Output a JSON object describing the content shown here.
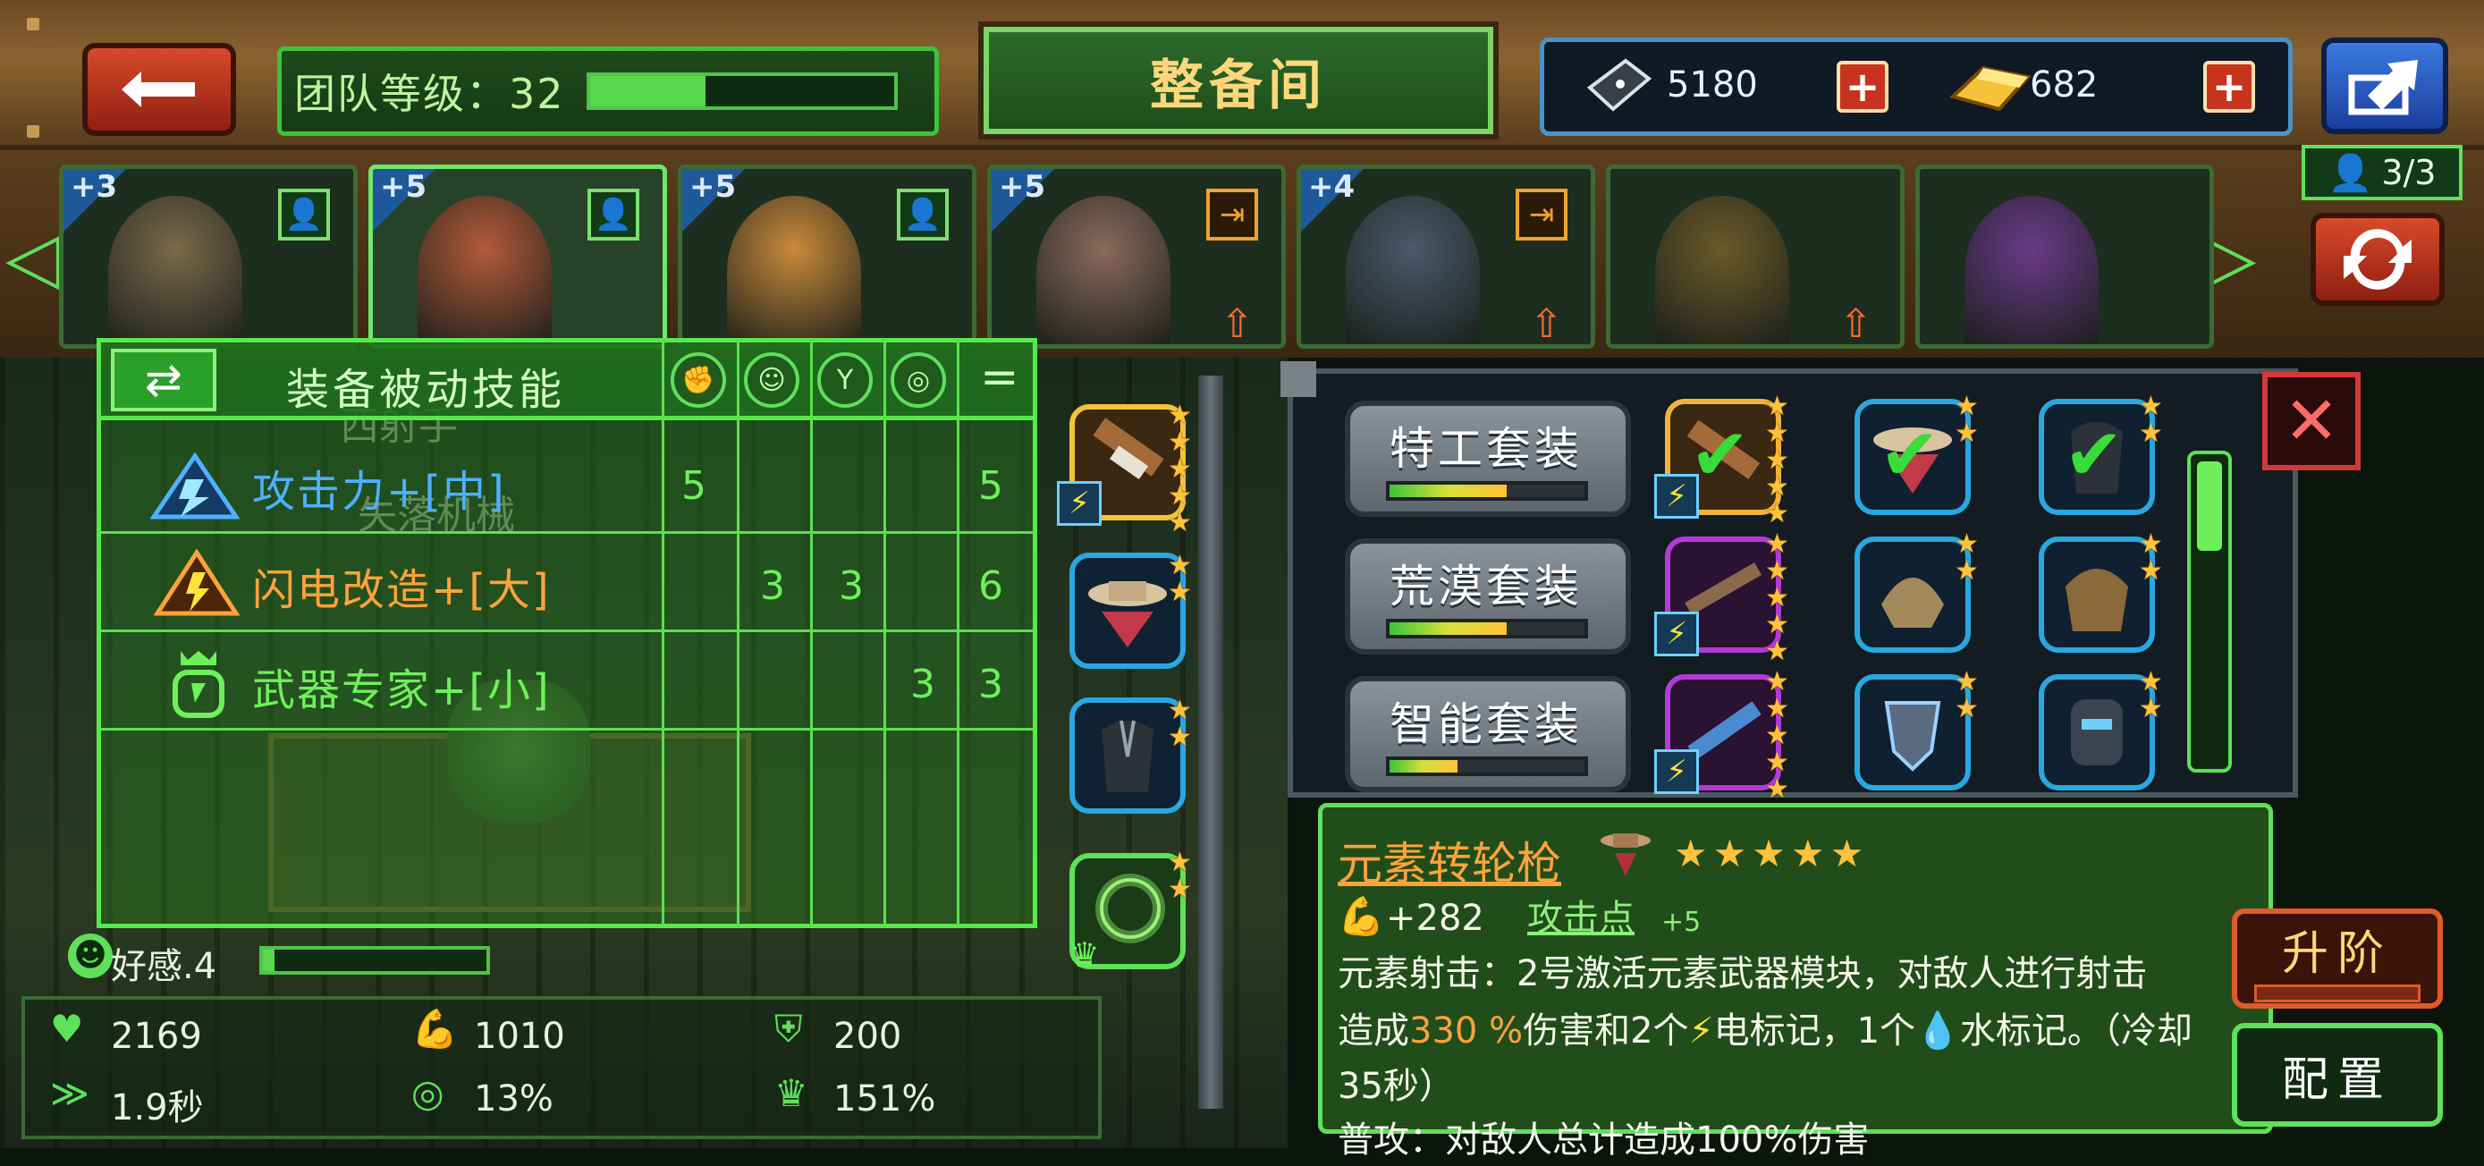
{
  "header": {
    "team_level_label": "团队等级：32",
    "team_level_progress": 0.38,
    "title": "整备间",
    "currency": [
      {
        "icon": "dark-gem-icon",
        "value": "5180"
      },
      {
        "icon": "gold-bar-icon",
        "value": "682"
      }
    ]
  },
  "roster": {
    "count": "3/3",
    "heroes": [
      {
        "stars": "+3",
        "badge": "person-icon",
        "selected": false
      },
      {
        "stars": "+5",
        "badge": "person-icon",
        "selected": true
      },
      {
        "stars": "+5",
        "badge": "person-icon",
        "selected": false
      },
      {
        "stars": "+5",
        "badge": "swap-badge-icon",
        "upgrade": true,
        "selected": false
      },
      {
        "stars": "+4",
        "badge": "swap-badge-icon",
        "upgrade": true,
        "selected": false
      },
      {
        "stars": "",
        "badge": "",
        "upgrade": true,
        "selected": false
      },
      {
        "stars": "",
        "badge": "",
        "selected": false
      }
    ]
  },
  "skills": {
    "title": "装备被动技能",
    "column_total_symbol": "=",
    "rows": [
      {
        "name": "攻击力+[中]",
        "color": "#4eb0ff",
        "values": [
          "5",
          "",
          "",
          "",
          "5"
        ]
      },
      {
        "name": "闪电改造+[大]",
        "color": "#ffa23a",
        "values": [
          "",
          "3",
          "3",
          "",
          "6"
        ]
      },
      {
        "name": "武器专家+[小]",
        "color": "#6ef05a",
        "values": [
          "",
          "",
          "",
          "3",
          "3"
        ]
      }
    ],
    "background_text": [
      "西射手",
      "失落机械"
    ]
  },
  "affinity": {
    "label": "好感.4",
    "progress": 0.05
  },
  "stats": [
    {
      "icon": "heart-icon",
      "value": "2169"
    },
    {
      "icon": "arm-strength-icon",
      "value": "1010"
    },
    {
      "icon": "armor-icon",
      "value": "200"
    },
    {
      "icon": "speed-wing-icon",
      "value": "1.9秒"
    },
    {
      "icon": "target-icon",
      "value": "13%"
    },
    {
      "icon": "crit-crown-icon",
      "value": "151%"
    }
  ],
  "inventory": {
    "sets": [
      {
        "name": "特工套装",
        "progress": 0.6
      },
      {
        "name": "荒漠套装",
        "progress": 0.6
      },
      {
        "name": "智能套装",
        "progress": 0.35
      }
    ]
  },
  "detail": {
    "item_name": "元素转轮枪",
    "stars": "★★★★★",
    "attack_bonus": "+282",
    "attack_point_label": "攻击点",
    "attack_point_value": "+5",
    "desc_line1": "元素射击：2号激活元素武器模块，对敌人进行射击",
    "desc_line2_a": "造成",
    "desc_line2_pct": "330 %",
    "desc_line2_b": "伤害和2个",
    "desc_line2_c": "电标记，1个",
    "desc_line2_d": "水标记。（冷却",
    "desc_line3": "35秒）",
    "desc_line4": "普攻：对敌人总计造成100%伤害"
  },
  "buttons": {
    "upgrade": "升阶",
    "config": "配置"
  },
  "colors": {
    "accent_green": "#5ee05a",
    "gold": "#ffc23a",
    "orange": "#ffa23a",
    "blue": "#4eb0ff"
  }
}
